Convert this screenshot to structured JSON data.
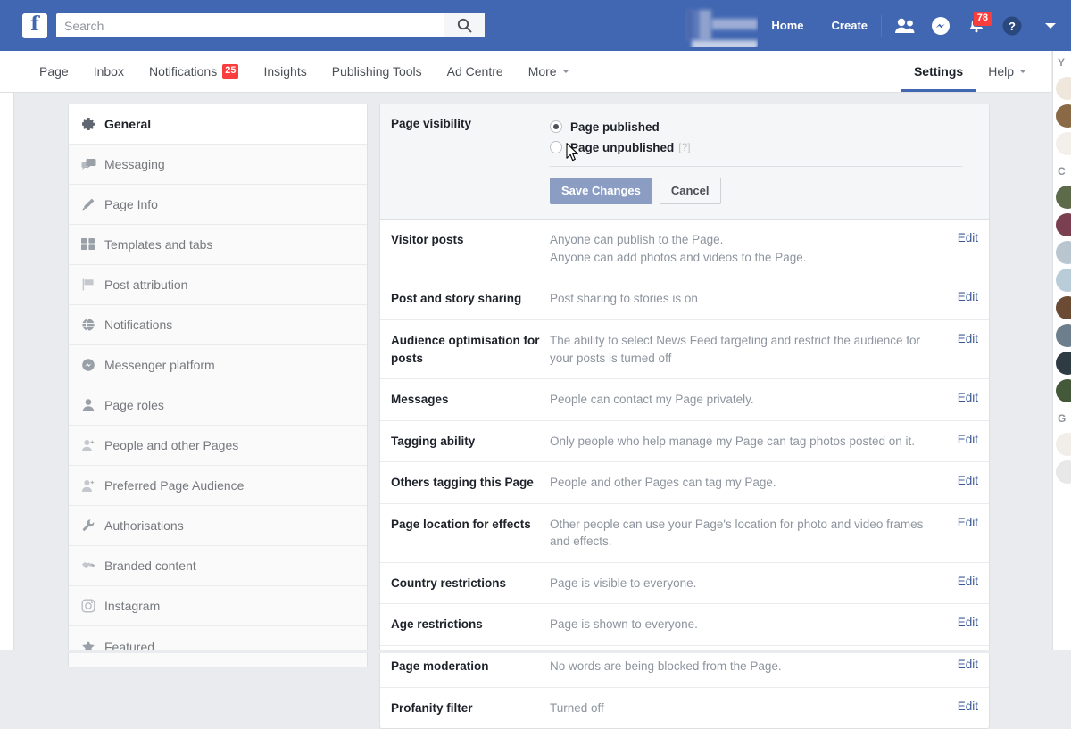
{
  "topbar": {
    "logo": "f",
    "search": {
      "placeholder": "Search",
      "value": "",
      "icon": "search-icon"
    },
    "profile_name": "",
    "home_label": "Home",
    "create_label": "Create",
    "icons": {
      "friend_requests": "friends-icon",
      "messenger": "messenger-icon",
      "notifications": "bell-icon",
      "help": "question-circle-icon",
      "account": "chevron-down-icon"
    },
    "notifications_count": "78",
    "accent_color": "#4267b2",
    "badge_color": "#fa3e3e"
  },
  "page_tabs": {
    "items": [
      {
        "label": "Page",
        "badge": "",
        "caret": false,
        "active": false
      },
      {
        "label": "Inbox",
        "badge": "",
        "caret": false,
        "active": false
      },
      {
        "label": "Notifications",
        "badge": "25",
        "caret": false,
        "active": false
      },
      {
        "label": "Insights",
        "badge": "",
        "caret": false,
        "active": false
      },
      {
        "label": "Publishing Tools",
        "badge": "",
        "caret": false,
        "active": false
      },
      {
        "label": "Ad Centre",
        "badge": "",
        "caret": false,
        "active": false
      },
      {
        "label": "More",
        "badge": "",
        "caret": true,
        "active": false
      }
    ],
    "right_items": [
      {
        "label": "Settings",
        "caret": false,
        "active": true
      },
      {
        "label": "Help",
        "caret": true,
        "active": false
      }
    ]
  },
  "sidebar": {
    "items": [
      {
        "label": "General",
        "icon": "gear-icon",
        "active": true
      },
      {
        "label": "Messaging",
        "icon": "chat-bubbles-icon",
        "active": false
      },
      {
        "label": "Page Info",
        "icon": "pencil-icon",
        "active": false
      },
      {
        "label": "Templates and tabs",
        "icon": "grid-squares-icon",
        "active": false
      },
      {
        "label": "Post attribution",
        "icon": "flag-icon",
        "active": false
      },
      {
        "label": "Notifications",
        "icon": "globe-icon",
        "active": false
      },
      {
        "label": "Messenger platform",
        "icon": "messenger-icon",
        "active": false
      },
      {
        "label": "Page roles",
        "icon": "person-icon",
        "active": false
      },
      {
        "label": "People and other Pages",
        "icon": "person-add-icon",
        "active": false
      },
      {
        "label": "Preferred Page Audience",
        "icon": "person-add-icon",
        "active": false
      },
      {
        "label": "Authorisations",
        "icon": "wrench-icon",
        "active": false
      },
      {
        "label": "Branded content",
        "icon": "handshake-icon",
        "active": false
      },
      {
        "label": "Instagram",
        "icon": "instagram-icon",
        "active": false
      },
      {
        "label": "Featured",
        "icon": "star-icon",
        "active": false
      }
    ]
  },
  "page_visibility": {
    "label": "Page visibility",
    "options": [
      {
        "label": "Page published",
        "checked": true,
        "help": ""
      },
      {
        "label": "Page unpublished",
        "checked": false,
        "help": "[?]"
      }
    ],
    "save_label": "Save Changes",
    "cancel_label": "Cancel",
    "save_color": "#8b9dc3"
  },
  "settings_rows": [
    {
      "label": "Visitor posts",
      "value": "Anyone can publish to the Page.\nAnyone can add photos and videos to the Page.",
      "action": "Edit"
    },
    {
      "label": "Post and story sharing",
      "value": "Post sharing to stories is on",
      "action": "Edit"
    },
    {
      "label": "Audience optimisation for posts",
      "value": "The ability to select News Feed targeting and restrict the audience for your posts is turned off",
      "action": "Edit"
    },
    {
      "label": "Messages",
      "value": "People can contact my Page privately.",
      "action": "Edit"
    },
    {
      "label": "Tagging ability",
      "value": "Only people who help manage my Page can tag photos posted on it.",
      "action": "Edit"
    },
    {
      "label": "Others tagging this Page",
      "value": "People and other Pages can tag my Page.",
      "action": "Edit"
    },
    {
      "label": "Page location for effects",
      "value": "Other people can use your Page's location for photo and video frames and effects.",
      "action": "Edit"
    },
    {
      "label": "Country restrictions",
      "value": "Page is visible to everyone.",
      "action": "Edit"
    },
    {
      "label": "Age restrictions",
      "value": "Page is shown to everyone.",
      "action": "Edit"
    },
    {
      "label": "Page moderation",
      "value": "No words are being blocked from the Page.",
      "action": "Edit"
    },
    {
      "label": "Profanity filter",
      "value": "Turned off",
      "action": "Edit"
    }
  ],
  "chat_rail": {
    "headings": [
      "Y",
      "C",
      "G"
    ],
    "avatars": [
      "#efe6dc",
      "#8a6a46",
      "#f3f0ec",
      "#5e6b4a",
      "#7b4050",
      "#b9c6cf",
      "#b9cdd8",
      "#6b4b33",
      "#6d7f8c",
      "#2f3b42",
      "#44593a",
      "#f1eee9",
      "#e8e8e8"
    ]
  }
}
